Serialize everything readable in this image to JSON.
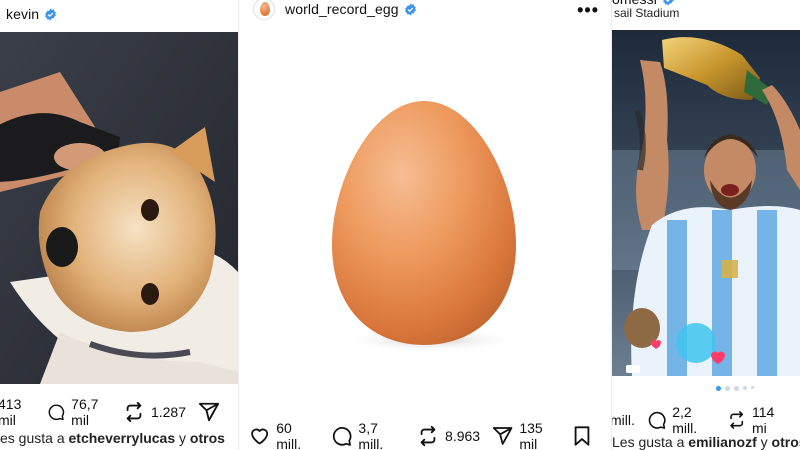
{
  "posts": {
    "left": {
      "username": "kevin",
      "verified": true,
      "likes": "413 mil",
      "comments": "76,7 mil",
      "reposts": "1.287",
      "liked_by_prefix": "es gusta a",
      "liked_by_user": "etcheverrylucas",
      "liked_by_suffix": "y",
      "liked_by_others": "otros",
      "photo_subject": "dog-photo"
    },
    "middle": {
      "username": "world_record_egg",
      "verified": true,
      "more_label": "•••",
      "likes": "60 mill.",
      "comments": "3,7 mill.",
      "reposts": "8.963",
      "shares": "135 mil",
      "photo_subject": "egg-photo"
    },
    "right": {
      "username": "omessi",
      "verified": true,
      "location": "sail Stadium",
      "likes": "mill.",
      "comments": "2,2 mill.",
      "reposts": "114 mi",
      "liked_by_prefix": "Les gusta a",
      "liked_by_user": "emilianozf",
      "liked_by_suffix": "y",
      "liked_by_others": "otros",
      "photo_subject": "messi-photo",
      "carousel_dots": 5,
      "carousel_active": 0
    }
  },
  "colors": {
    "verified_blue": "#3797f0",
    "egg_orange": "#e88745",
    "argentina_blue": "#74b4e6"
  },
  "icons": [
    "heart-icon",
    "comment-icon",
    "repost-icon",
    "share-icon",
    "bookmark-icon",
    "verified-icon",
    "more-icon"
  ]
}
